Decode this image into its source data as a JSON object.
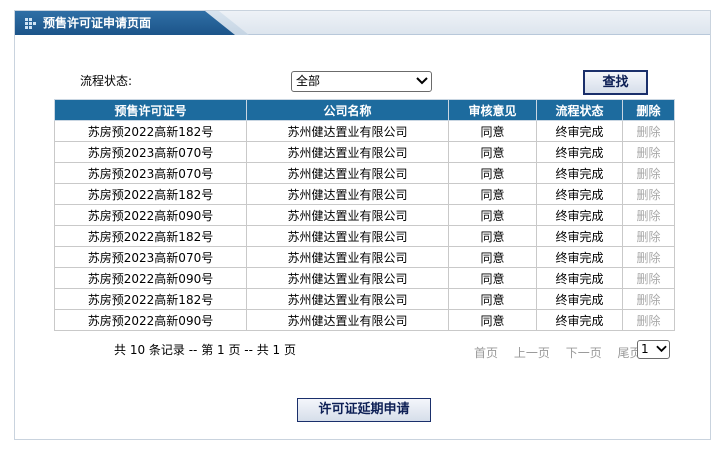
{
  "header": {
    "title": "预售许可证申请页面",
    "icon": "dots-grid-icon"
  },
  "filter": {
    "label": "流程状态:",
    "selected": "全部",
    "search_label": "查找"
  },
  "table": {
    "columns": [
      "预售许可证号",
      "公司名称",
      "审核意见",
      "流程状态",
      "删除"
    ],
    "rows": [
      [
        "苏房预2022高新182号",
        "苏州健达置业有限公司",
        "同意",
        "终审完成",
        "删除"
      ],
      [
        "苏房预2023高新070号",
        "苏州健达置业有限公司",
        "同意",
        "终审完成",
        "删除"
      ],
      [
        "苏房预2023高新070号",
        "苏州健达置业有限公司",
        "同意",
        "终审完成",
        "删除"
      ],
      [
        "苏房预2022高新182号",
        "苏州健达置业有限公司",
        "同意",
        "终审完成",
        "删除"
      ],
      [
        "苏房预2022高新090号",
        "苏州健达置业有限公司",
        "同意",
        "终审完成",
        "删除"
      ],
      [
        "苏房预2022高新182号",
        "苏州健达置业有限公司",
        "同意",
        "终审完成",
        "删除"
      ],
      [
        "苏房预2023高新070号",
        "苏州健达置业有限公司",
        "同意",
        "终审完成",
        "删除"
      ],
      [
        "苏房预2022高新090号",
        "苏州健达置业有限公司",
        "同意",
        "终审完成",
        "删除"
      ],
      [
        "苏房预2022高新182号",
        "苏州健达置业有限公司",
        "同意",
        "终审完成",
        "删除"
      ],
      [
        "苏房预2022高新090号",
        "苏州健达置业有限公司",
        "同意",
        "终审完成",
        "删除"
      ]
    ]
  },
  "footer": {
    "summary": "共 10 条记录 -- 第 1 页 -- 共 1 页",
    "first": "首页",
    "prev": "上一页",
    "next": "下一页",
    "last": "尾页",
    "page": "1"
  },
  "extend_button": "许可证延期申请",
  "colors": {
    "header_blue": "#1d6b9e",
    "tab_blue": "#1c5489",
    "button_text": "#0d1f55",
    "disabled_gray": "#a8a8a8"
  }
}
